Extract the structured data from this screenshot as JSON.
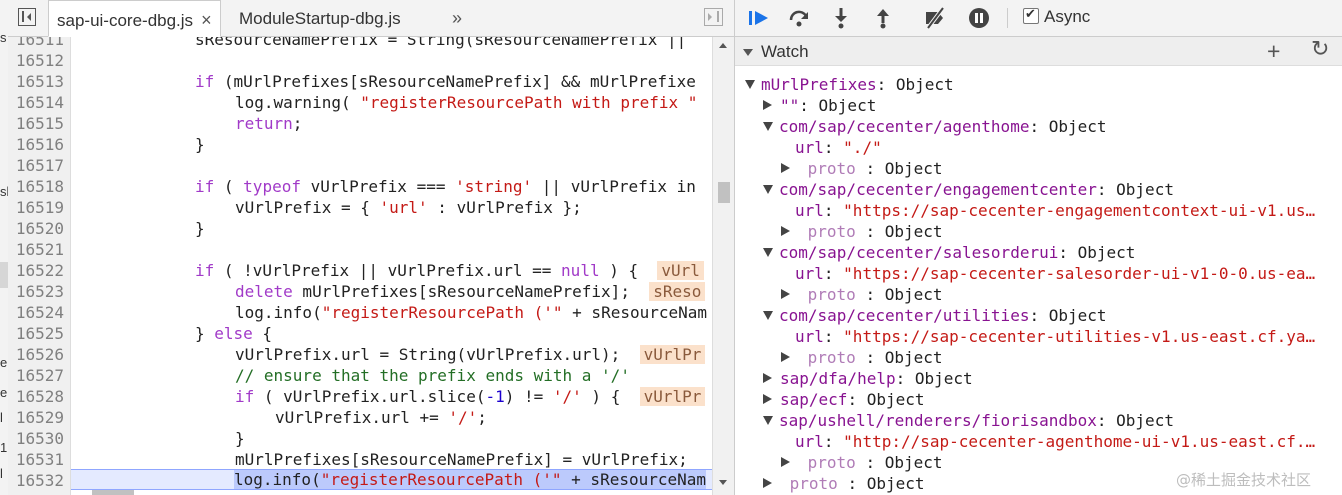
{
  "editor": {
    "tabs": [
      {
        "label": "sap-ui-core-dbg.js",
        "active": true
      },
      {
        "label": "ModuleStartup-dbg.js",
        "active": false
      }
    ],
    "close_glyph": "×",
    "more_glyph": "»",
    "line_numbers": [
      "16511",
      "16512",
      "16513",
      "16514",
      "16515",
      "16516",
      "16517",
      "16518",
      "16519",
      "16520",
      "16521",
      "16522",
      "16523",
      "16524",
      "16525",
      "16526",
      "16527",
      "16528",
      "16529",
      "16530",
      "16531",
      "16532"
    ],
    "code": {
      "l16511": "sResourceNamePrefix = String(sResourceNamePrefix ||",
      "l16513_kw": "if",
      "l16513_rest": " (mUrlPrefixes[sResourceNamePrefix] && mUrlPrefixe",
      "l16514_a": "log.warning( ",
      "l16514_str": "\"registerResourcePath with prefix \"",
      "l16515_kw": "return",
      "l16515_rest": ";",
      "l16516": "}",
      "l16518_kw1": "if",
      "l16518_a": " ( ",
      "l16518_kw2": "typeof",
      "l16518_b": " vUrlPrefix === ",
      "l16518_str": "'string'",
      "l16518_c": " || vUrlPrefix in",
      "l16519_a": "vUrlPrefix = { ",
      "l16519_str": "'url'",
      "l16519_b": " : vUrlPrefix };",
      "l16520": "}",
      "l16522_kw": "if",
      "l16522_rest": " ( !vUrlPrefix || vUrlPrefix.url == ",
      "l16522_null": "null",
      "l16522_end": " ) {  ",
      "l16522_badge": "vUrl",
      "l16523_kw": "delete",
      "l16523_rest": " mUrlPrefixes[sResourceNamePrefix];  ",
      "l16523_badge": "sReso",
      "l16524_a": "log.info(",
      "l16524_str": "\"registerResourcePath ('\"",
      "l16524_b": " + sResourceNam",
      "l16525_a": "} ",
      "l16525_kw": "else",
      "l16525_b": " {",
      "l16526_a": "vUrlPrefix.url = String(vUrlPrefix.url);  ",
      "l16526_badge": "vUrlPr",
      "l16527": "// ensure that the prefix ends with a '/'",
      "l16528_kw": "if",
      "l16528_a": " ( vUrlPrefix.url.slice(",
      "l16528_num": "-1",
      "l16528_b": ") != ",
      "l16528_str": "'/'",
      "l16528_c": " ) {  ",
      "l16528_badge": "vUrlPr",
      "l16529_a": "vUrlPrefix.url += ",
      "l16529_str": "'/'",
      "l16529_b": ";",
      "l16530": "}",
      "l16531": "mUrlPrefixes[sResourceNamePrefix] = vUrlPrefix;",
      "l16532_a": "log.info(",
      "l16532_str": "\"registerResourcePath ('\"",
      "l16532_b": " + sResourceNam"
    }
  },
  "left_strip": [
    "s",
    "sl",
    "e",
    "e",
    "l",
    "1",
    "l"
  ],
  "debugger": {
    "async_label": "Async",
    "async_checked": true,
    "watch_title": "Watch",
    "add_glyph": "+",
    "refresh_glyph": "↻",
    "tree": {
      "root_name": "mUrlPrefixes",
      "root_type": ": Object",
      "n1_key": "\"\"",
      "n1_type": ": Object",
      "n2_key": "com/sap/cecenter/agenthome",
      "n2_type": ": Object",
      "n2_url_key": "url",
      "n2_url_val": "\"./\"",
      "proto_label": "proto",
      "proto_type": " : Object",
      "n3_key": "com/sap/cecenter/engagementcenter",
      "n3_type": ": Object",
      "n3_url_val": "\"https://sap-cecenter-engagementcontext-ui-v1.us…",
      "n4_key": "com/sap/cecenter/salesorderui",
      "n4_type": ": Object",
      "n4_url_val": "\"https://sap-cecenter-salesorder-ui-v1-0-0.us-ea…",
      "n5_key": "com/sap/cecenter/utilities",
      "n5_type": ": Object",
      "n5_url_val": "\"https://sap-cecenter-utilities-v1.us-east.cf.ya…",
      "n6_key": "sap/dfa/help",
      "n6_type": ": Object",
      "n7_key": "sap/ecf",
      "n7_type": ": Object",
      "n8_key": "sap/ushell/renderers/fiorisandbox",
      "n8_type": ": Object",
      "n8_url_val": "\"http://sap-cecenter-agenthome-ui-v1.us-east.cf.…"
    }
  },
  "watermark": "@稀土掘金技术社区",
  "colors": {
    "keyword": "#a13ac8",
    "string": "#c41a16",
    "comment": "#236e25",
    "property": "#881391",
    "accent": "#1a73e8"
  }
}
